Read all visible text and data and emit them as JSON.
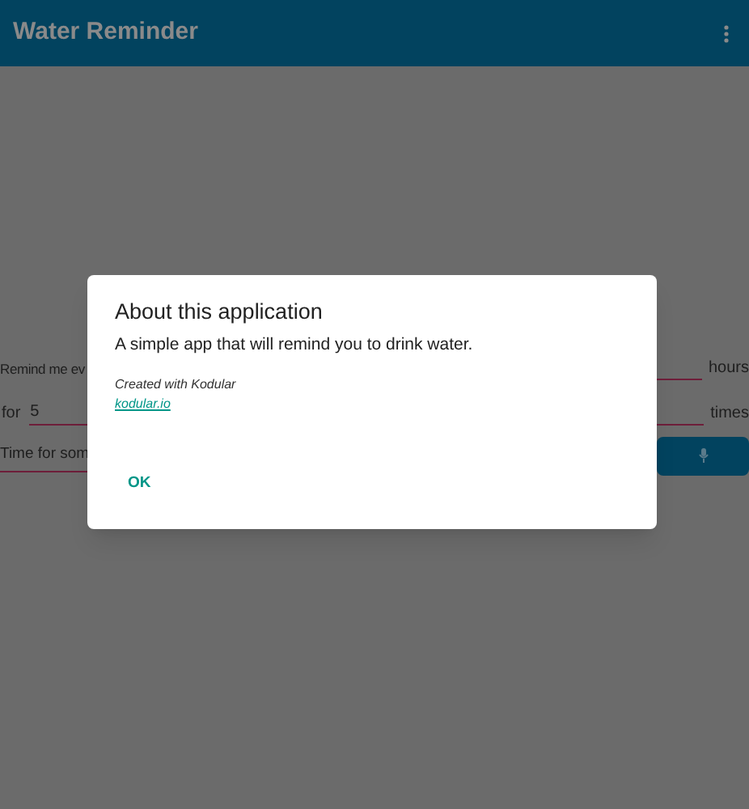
{
  "app_bar": {
    "title": "Water Reminder"
  },
  "form": {
    "interval_label": "Remind me ev",
    "interval_unit": "hours",
    "count_label": "for",
    "count_value": "5",
    "count_unit": "times",
    "message_value": "Time for som"
  },
  "dialog": {
    "title": "About this application",
    "message": "A simple app that will remind you to drink water.",
    "credit": "Created with Kodular",
    "link": "kodular.io",
    "button": "OK"
  }
}
